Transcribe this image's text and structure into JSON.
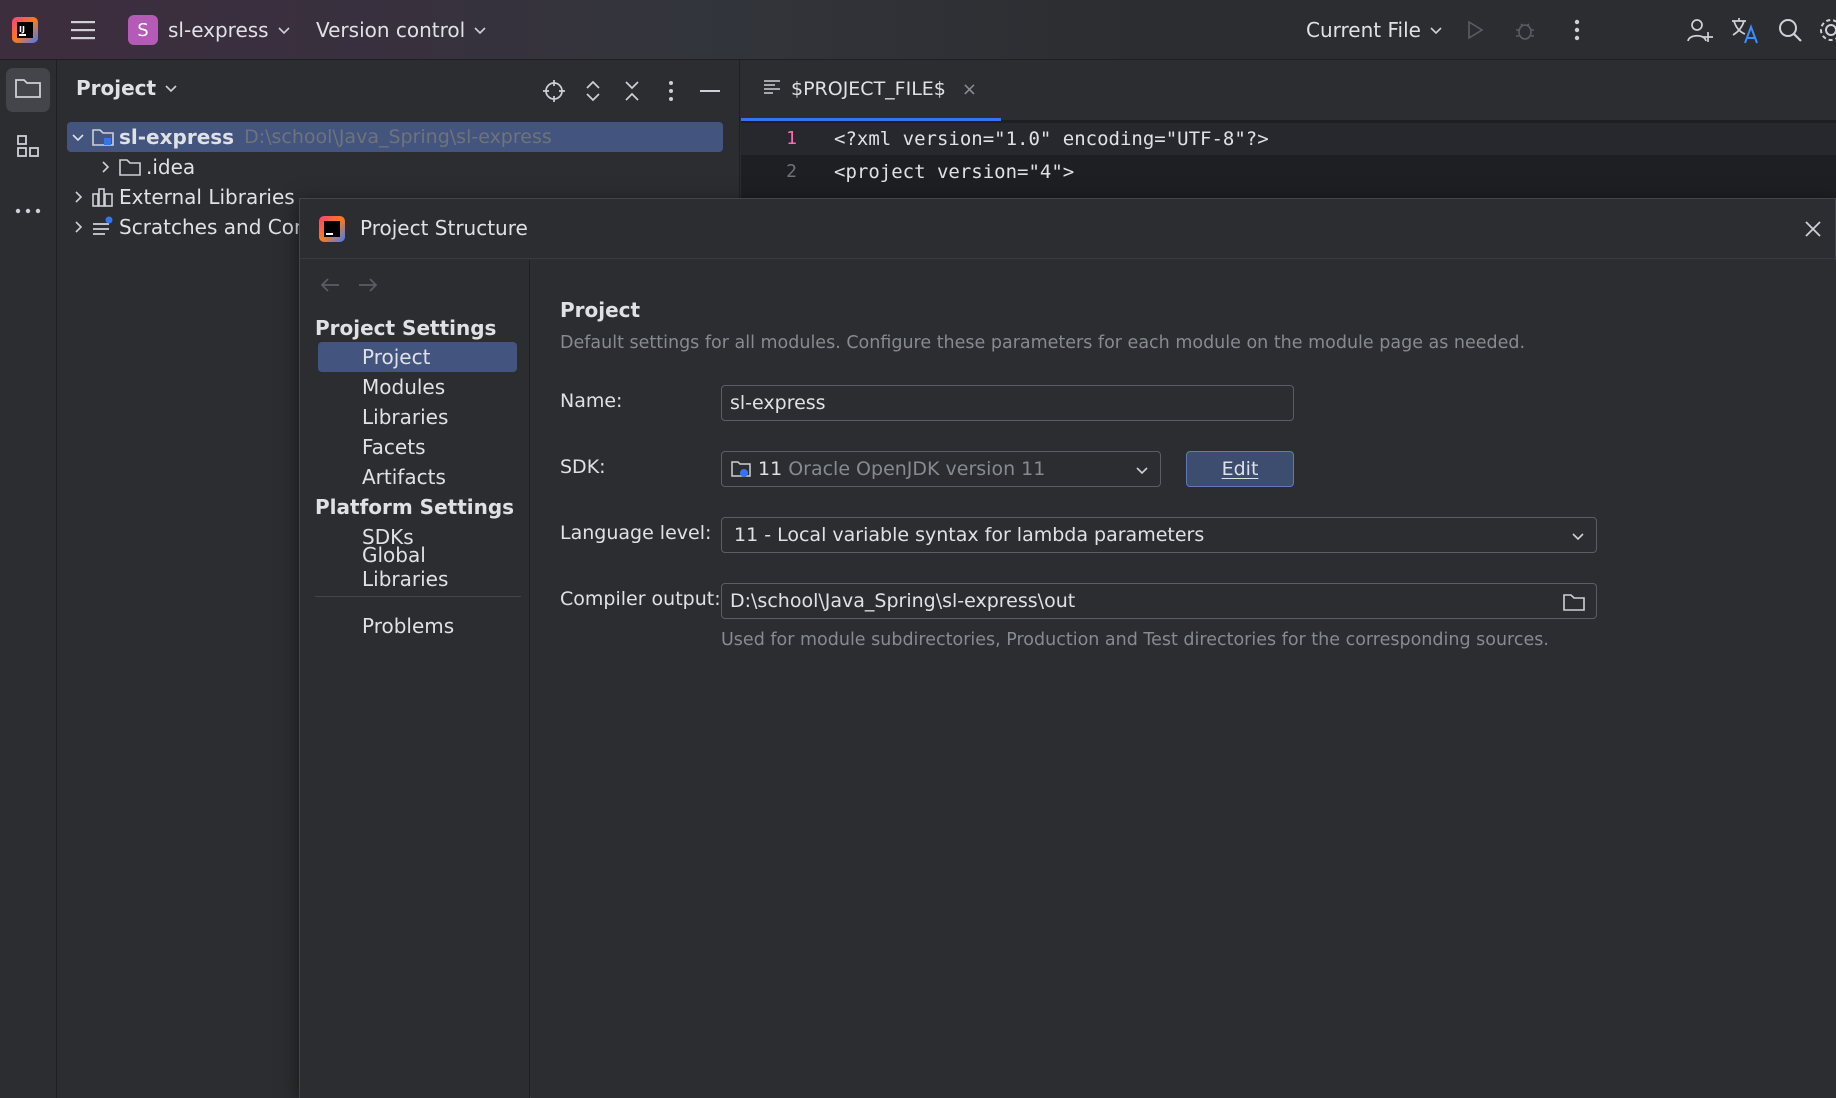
{
  "topbar": {
    "project_badge": "S",
    "project_name": "sl-express",
    "vcs_label": "Version control",
    "run_config": "Current File"
  },
  "project_panel": {
    "title": "Project",
    "tree": [
      {
        "name": "sl-express",
        "path": "D:\\school\\Java_Spring\\sl-express"
      },
      {
        "name": ".idea"
      },
      {
        "name": "External Libraries"
      },
      {
        "name": "Scratches and Cons"
      }
    ]
  },
  "editor": {
    "tab_label": "$PROJECT_FILE$",
    "tab_close": "×",
    "lines": [
      {
        "num": "1",
        "text": "<?xml version=\"1.0\" encoding=\"UTF-8\"?>"
      },
      {
        "num": "2",
        "text": "<project version=\"4\">"
      }
    ]
  },
  "dialog": {
    "title": "Project Structure",
    "sidebar": {
      "project_settings_header": "Project Settings",
      "project_settings": [
        "Project",
        "Modules",
        "Libraries",
        "Facets",
        "Artifacts"
      ],
      "platform_settings_header": "Platform Settings",
      "platform_settings": [
        "SDKs",
        "Global Libraries"
      ],
      "problems": "Problems"
    },
    "main": {
      "section_title": "Project",
      "section_desc": "Default settings for all modules. Configure these parameters for each module on the module page as needed.",
      "name_label": "Name:",
      "name_value": "sl-express",
      "sdk_label": "SDK:",
      "sdk_version": "11",
      "sdk_name": "Oracle OpenJDK version 11",
      "edit_button": "Edit",
      "language_level_label": "Language level:",
      "language_level_value": "11 - Local variable syntax for lambda parameters",
      "compiler_output_label": "Compiler output:",
      "compiler_output_value": "D:\\school\\Java_Spring\\sl-express\\out",
      "compiler_output_hint": "Used for module subdirectories, Production and Test directories for the corresponding sources."
    }
  },
  "colors": {
    "accent": "#3574f0",
    "selection": "#43547f",
    "badge": "#b35bb6"
  }
}
